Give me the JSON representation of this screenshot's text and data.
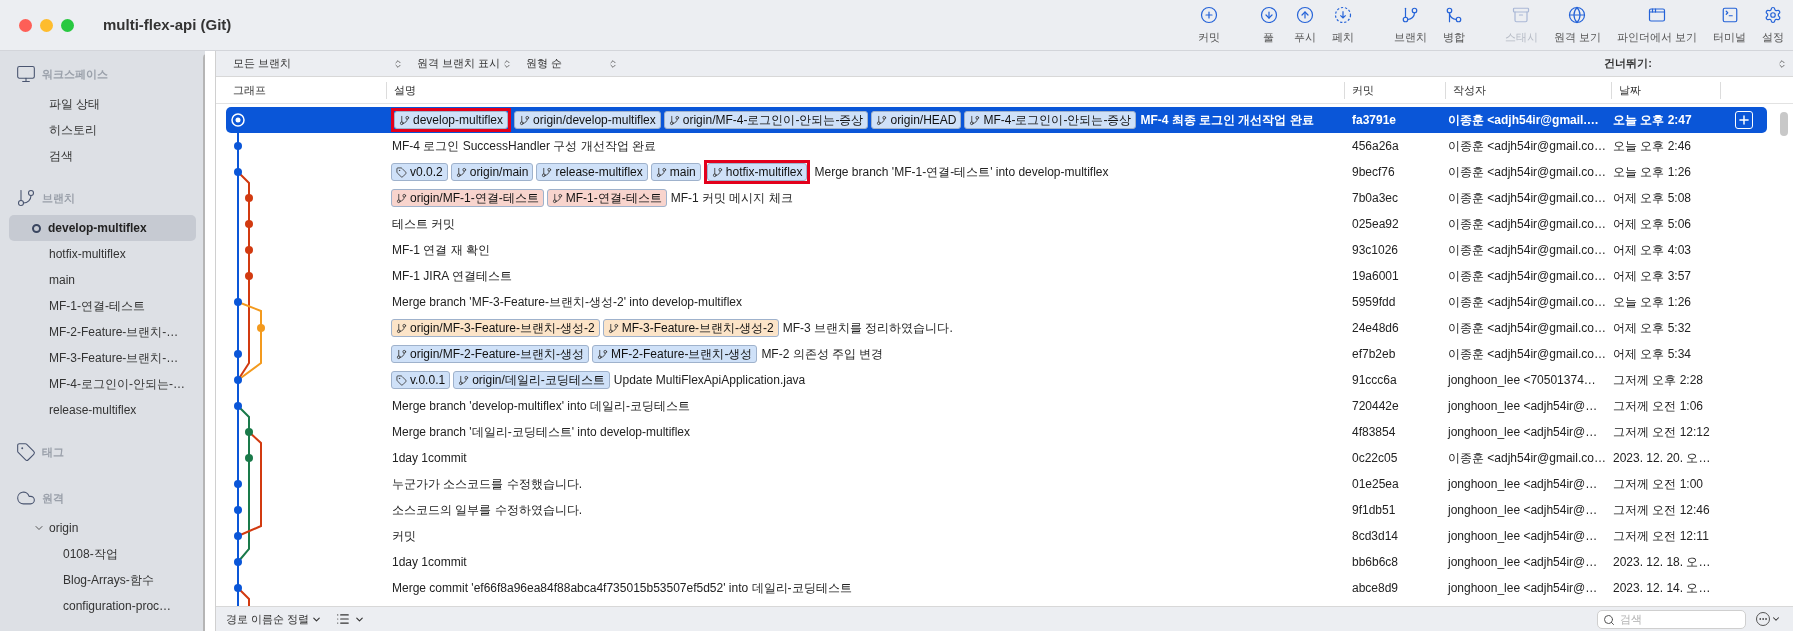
{
  "window": {
    "title": "multi-flex-api (Git)"
  },
  "toolbar": {
    "groups": [
      {
        "items": [
          {
            "kind": "commit",
            "label": "커밋",
            "disabled": false
          }
        ]
      },
      {
        "items": [
          {
            "kind": "pull",
            "label": "풀",
            "disabled": false
          },
          {
            "kind": "push",
            "label": "푸시",
            "disabled": false
          },
          {
            "kind": "fetch",
            "label": "페치",
            "disabled": false
          }
        ]
      },
      {
        "items": [
          {
            "kind": "branch",
            "label": "브랜치",
            "disabled": false
          },
          {
            "kind": "merge",
            "label": "병합",
            "disabled": false
          }
        ]
      },
      {
        "items": [
          {
            "kind": "stash",
            "label": "스태시",
            "disabled": true
          },
          {
            "kind": "remote",
            "label": "원격 보기",
            "disabled": false
          },
          {
            "kind": "finder",
            "label": "파인더에서 보기",
            "disabled": false
          },
          {
            "kind": "terminal",
            "label": "터미널",
            "disabled": false
          },
          {
            "kind": "settings",
            "label": "설정",
            "disabled": false
          }
        ]
      }
    ]
  },
  "sidebar": {
    "sections": [
      {
        "kind": "workspace",
        "label": "워크스페이스",
        "items": [
          {
            "label": "파일 상태",
            "selected": false
          },
          {
            "label": "히스토리",
            "selected": false
          },
          {
            "label": "검색",
            "selected": false
          }
        ]
      },
      {
        "kind": "branches",
        "label": "브랜치",
        "items": [
          {
            "label": "develop-multiflex",
            "selected": true
          },
          {
            "label": "hotfix-multiflex",
            "selected": false
          },
          {
            "label": "main",
            "selected": false
          },
          {
            "label": "MF-1-연결-테스트",
            "selected": false
          },
          {
            "label": "MF-2-Feature-브랜치-…",
            "selected": false
          },
          {
            "label": "MF-3-Feature-브랜치-…",
            "selected": false
          },
          {
            "label": "MF-4-로그인이-안되는-…",
            "selected": false
          },
          {
            "label": "release-multiflex",
            "selected": false
          }
        ]
      },
      {
        "kind": "tags",
        "label": "태그"
      },
      {
        "kind": "remotes",
        "label": "원격",
        "items": [
          {
            "label": "origin",
            "selected": false,
            "expanded": true,
            "children": [
              {
                "label": "0108-작업",
                "selected": false
              },
              {
                "label": "Blog-Arrays-함수",
                "selected": false
              },
              {
                "label": "configuration-proc…",
                "selected": false
              }
            ]
          }
        ]
      }
    ]
  },
  "filters": [
    {
      "label": "모든 브랜치"
    },
    {
      "label": "원격 브랜치 표시"
    },
    {
      "label": "원형 순"
    }
  ],
  "jump": {
    "label": "건너뛰기:"
  },
  "table": {
    "columns": [
      "그래프",
      "설명",
      "커밋",
      "작성자",
      "날짜"
    ],
    "rows": [
      {
        "selected": true,
        "refs": [
          {
            "kind": "branch",
            "label": "develop-multiflex",
            "color": "#cfe1f8",
            "highlighted": true
          },
          {
            "kind": "branch",
            "label": "origin/develop-multiflex",
            "color": "#cfe1f8",
            "highlighted": false
          },
          {
            "kind": "branch",
            "label": "origin/MF-4-로그인이-안되는-증상",
            "color": "#cfe1f8",
            "highlighted": false
          },
          {
            "kind": "branch",
            "label": "origin/HEAD",
            "color": "#cfe1f8",
            "highlighted": false
          },
          {
            "kind": "branch",
            "label": "MF-4-로그인이-안되는-증상",
            "color": "#cfe1f8",
            "highlighted": false
          }
        ],
        "message": "MF-4 최종 로그인 개선작업 완료",
        "commit": "fa3791e",
        "author": "이종훈 <adjh54ir@gmail.…",
        "date": "오늘 오후 2:47"
      },
      {
        "selected": false,
        "refs": [],
        "message": "MF-4 로그인 SuccessHandler 구성 개선작업 완료",
        "commit": "456a26a",
        "author": "이종훈 <adjh54ir@gmail.co…",
        "date": "오늘 오후 2:46"
      },
      {
        "selected": false,
        "refs": [
          {
            "kind": "tag",
            "label": "v0.0.2",
            "color": "#cfe1f8",
            "highlighted": false
          },
          {
            "kind": "branch",
            "label": "origin/main",
            "color": "#cfe1f8",
            "highlighted": false
          },
          {
            "kind": "branch",
            "label": "release-multiflex",
            "color": "#cfe1f8",
            "highlighted": false
          },
          {
            "kind": "branch",
            "label": "main",
            "color": "#cfe1f8",
            "highlighted": false
          },
          {
            "kind": "branch",
            "label": "hotfix-multiflex",
            "color": "#cfe1f8",
            "highlighted": true
          }
        ],
        "message": "Merge branch 'MF-1-연결-테스트' into develop-multiflex",
        "commit": "9becf76",
        "author": "이종훈 <adjh54ir@gmail.co…",
        "date": "오늘 오후 1:26"
      },
      {
        "selected": false,
        "refs": [
          {
            "kind": "branch",
            "label": "origin/MF-1-연결-테스트",
            "color": "#f8d4cd",
            "highlighted": false
          },
          {
            "kind": "branch",
            "label": "MF-1-연결-테스트",
            "color": "#f8d4cd",
            "highlighted": false
          }
        ],
        "message": "MF-1 커밋 메시지 체크",
        "commit": "7b0a3ec",
        "author": "이종훈 <adjh54ir@gmail.co…",
        "date": "어제 오후 5:08"
      },
      {
        "selected": false,
        "refs": [],
        "message": "테스트 커밋",
        "commit": "025ea92",
        "author": "이종훈 <adjh54ir@gmail.co…",
        "date": "어제 오후 5:06"
      },
      {
        "selected": false,
        "refs": [],
        "message": "MF-1 연결 재 확인",
        "commit": "93c1026",
        "author": "이종훈 <adjh54ir@gmail.co…",
        "date": "어제 오후 4:03"
      },
      {
        "selected": false,
        "refs": [],
        "message": "MF-1 JIRA 연결테스트",
        "commit": "19a6001",
        "author": "이종훈 <adjh54ir@gmail.co…",
        "date": "어제 오후 3:57"
      },
      {
        "selected": false,
        "refs": [],
        "message": "Merge branch 'MF-3-Feature-브랜치-생성-2' into develop-multiflex",
        "commit": "5959fdd",
        "author": "이종훈 <adjh54ir@gmail.co…",
        "date": "오늘 오후 1:26"
      },
      {
        "selected": false,
        "refs": [
          {
            "kind": "branch",
            "label": "origin/MF-3-Feature-브랜치-생성-2",
            "color": "#fce4c8",
            "highlighted": false
          },
          {
            "kind": "branch",
            "label": "MF-3-Feature-브랜치-생성-2",
            "color": "#fce4c8",
            "highlighted": false
          }
        ],
        "message": "MF-3 브랜치를 정리하였습니다.",
        "commit": "24e48d6",
        "author": "이종훈 <adjh54ir@gmail.co…",
        "date": "어제 오후 5:32"
      },
      {
        "selected": false,
        "refs": [
          {
            "kind": "branch",
            "label": "origin/MF-2-Feature-브랜치-생성",
            "color": "#cfe1f8",
            "highlighted": false
          },
          {
            "kind": "branch",
            "label": "MF-2-Feature-브랜치-생성",
            "color": "#cfe1f8",
            "highlighted": false
          }
        ],
        "message": "MF-2 의존성 주입 변경",
        "commit": "ef7b2eb",
        "author": "이종훈 <adjh54ir@gmail.co…",
        "date": "어제 오후 5:34"
      },
      {
        "selected": false,
        "refs": [
          {
            "kind": "tag",
            "label": "v.0.0.1",
            "color": "#cfe1f8",
            "highlighted": false
          },
          {
            "kind": "branch",
            "label": "origin/데일리-코딩테스트",
            "color": "#cfe1f8",
            "highlighted": false
          }
        ],
        "message": "Update MultiFlexApiApplication.java",
        "commit": "91ccc6a",
        "author": "jonghoon_lee <70501374…",
        "date": "그저께 오후 2:28"
      },
      {
        "selected": false,
        "refs": [],
        "message": "Merge branch 'develop-multiflex' into 데일리-코딩테스트",
        "commit": "720442e",
        "author": "jonghoon_lee <adjh54ir@…",
        "date": "그저께 오전 1:06"
      },
      {
        "selected": false,
        "refs": [],
        "message": "Merge branch '데일리-코딩테스트' into develop-multiflex",
        "commit": "4f83854",
        "author": "jonghoon_lee <adjh54ir@…",
        "date": "그저께 오전 12:12"
      },
      {
        "selected": false,
        "refs": [],
        "message": "1day 1commit",
        "commit": "0c22c05",
        "author": "이종훈 <adjh54ir@gmail.co…",
        "date": "2023. 12. 20. 오…"
      },
      {
        "selected": false,
        "refs": [],
        "message": "누군가가 소스코드를 수정했습니다.",
        "commit": "01e25ea",
        "author": "jonghoon_lee <adjh54ir@…",
        "date": "그저께 오전 1:00"
      },
      {
        "selected": false,
        "refs": [],
        "message": "소스코드의 일부를 수정하였습니다.",
        "commit": "9f1db51",
        "author": "jonghoon_lee <adjh54ir@…",
        "date": "그저께 오전 12:46"
      },
      {
        "selected": false,
        "refs": [],
        "message": "커밋",
        "commit": "8cd3d14",
        "author": "jonghoon_lee <adjh54ir@…",
        "date": "그저께 오전 12:11"
      },
      {
        "selected": false,
        "refs": [],
        "message": "1day 1commit",
        "commit": "bb6b6c8",
        "author": "jonghoon_lee <adjh54ir@…",
        "date": "2023. 12. 18. 오…"
      },
      {
        "selected": false,
        "refs": [],
        "message": "Merge commit 'ef66f8a96ea84f88abca4f735015b53507ef5d52' into 데일리-코딩테스트",
        "commit": "abce8d9",
        "author": "jonghoon_lee <adjh54ir@…",
        "date": "2023. 12. 14. 오…"
      }
    ]
  },
  "bottom_bar": {
    "sort": "경로 이름순 정렬",
    "search": {
      "placeholder": "검색"
    }
  }
}
